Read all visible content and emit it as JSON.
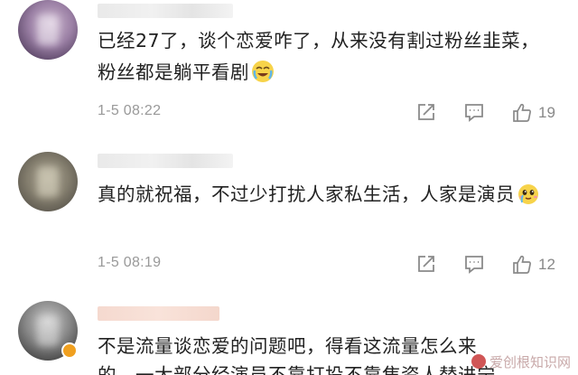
{
  "comments": [
    {
      "text": "已经27了，谈个恋爱咋了，从来没有割过粉丝韭菜，粉丝都是躺平看剧",
      "emoji": "crying-laughing-emoji",
      "time": "1-5 08:22",
      "likes": "19"
    },
    {
      "text": "真的就祝福，不过少打扰人家私生活，人家是演员",
      "emoji": "cute-crying-emoji",
      "time": "1-5 08:19",
      "likes": "12"
    },
    {
      "text": "不是流量谈恋爱的问题吧，得看这流量怎么来",
      "text2": "的，一大部分经演员不靠打投不靠焦资人替进宁"
    }
  ],
  "watermark": {
    "text": "爱创根知识网"
  },
  "colors": {
    "meta": "#999999",
    "text": "#222222"
  }
}
